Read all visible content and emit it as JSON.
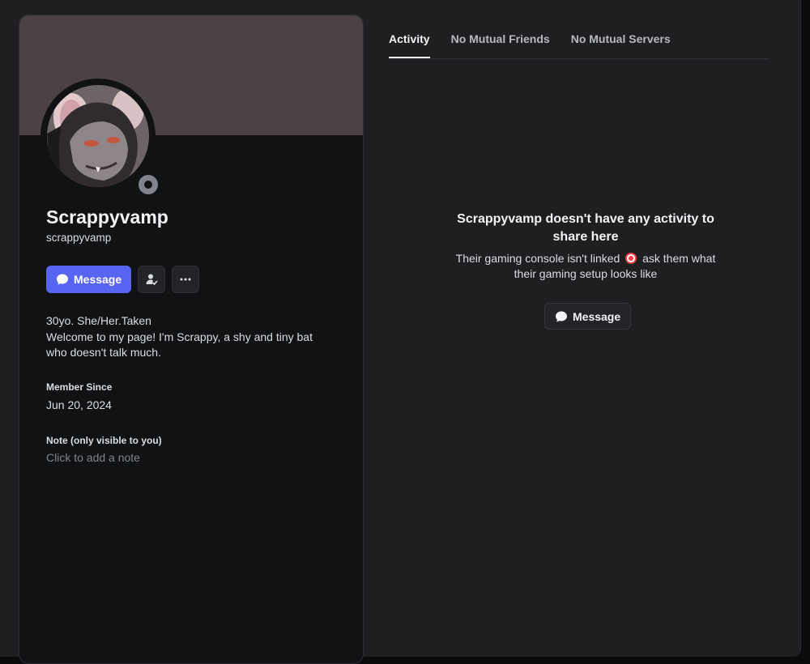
{
  "profile": {
    "display_name": "Scrappyvamp",
    "username": "scrappyvamp",
    "banner_color": "#4a4244",
    "status": "offline",
    "avatar_icon": "avatar-image",
    "bio_line1": "30yo. She/Her.Taken",
    "bio_line2": "Welcome to my page! I'm Scrappy, a shy and tiny bat who doesn't talk much.",
    "member_since_label": "Member Since",
    "member_since_value": "Jun 20, 2024",
    "note_label": "Note (only visible to you)",
    "note_placeholder": "Click to add a note"
  },
  "actions": {
    "message_label": "Message",
    "message_icon": "chat-bubble-icon",
    "friend_icon": "user-check-icon",
    "more_icon": "ellipsis-icon"
  },
  "tabs": [
    {
      "label": "Activity",
      "active": true
    },
    {
      "label": "No Mutual Friends",
      "active": false
    },
    {
      "label": "No Mutual Servers",
      "active": false
    }
  ],
  "activity_empty": {
    "title": "Scrappyvamp doesn't have any activity to share here",
    "subtitle_part1": "Their gaming console isn't linked",
    "subtitle_emoji": "direct-hit-emoji",
    "subtitle_part2": "ask them what their gaming setup looks like",
    "button_label": "Message"
  },
  "colors": {
    "accent": "#5865f2",
    "background": "#1f1f22",
    "card": "#111214"
  }
}
